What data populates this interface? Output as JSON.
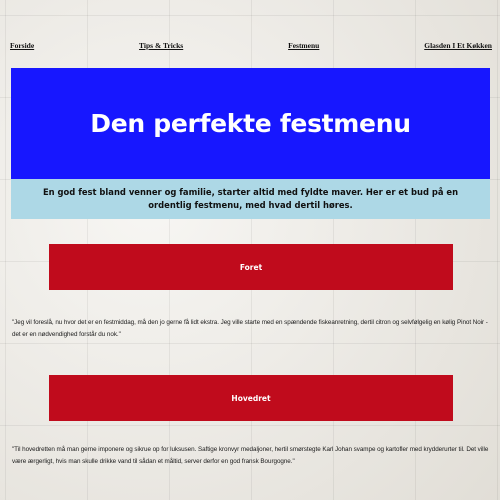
{
  "nav": {
    "items": [
      {
        "label": "Forside"
      },
      {
        "label": "Tips & Tricks"
      },
      {
        "label": "Festmenu"
      },
      {
        "label": "Glasden I Et Køkken"
      }
    ]
  },
  "hero": {
    "title": "Den perfekte festmenu"
  },
  "intro": {
    "text": "En god fest bland venner og familie, starter altid med fyldte maver. Her er et bud på en ordentlig festmenu, med hvad dertil høres."
  },
  "sections": [
    {
      "button_label": "Foret",
      "quote": "\"Jeg vil foreslå, nu hvor det er en festmiddag, må den jo gerne få lidt ekstra. Jeg ville starte med en spændende fiskeanretning, dertil citron og selvfølgelig en kølig Pinot Noir - det er en nødvendighed forstår du nok.\""
    },
    {
      "button_label": "Hovedret",
      "quote": "\"Til hovedretten må man gerne imponere og sikrue op for luksusen. Saftige kronvyr medaljoner, hertil smørstegte Karl Johan svampe og kartofler med krydderurter til. Det ville være ærgerligt, hvis man skulle drikke vand til sådan et måltid, server derfor en god fransk Bourgogne.\""
    }
  ],
  "colors": {
    "hero_bg": "#1717ff",
    "intro_bg": "#add8e6",
    "button_bg": "#c00b1c"
  }
}
